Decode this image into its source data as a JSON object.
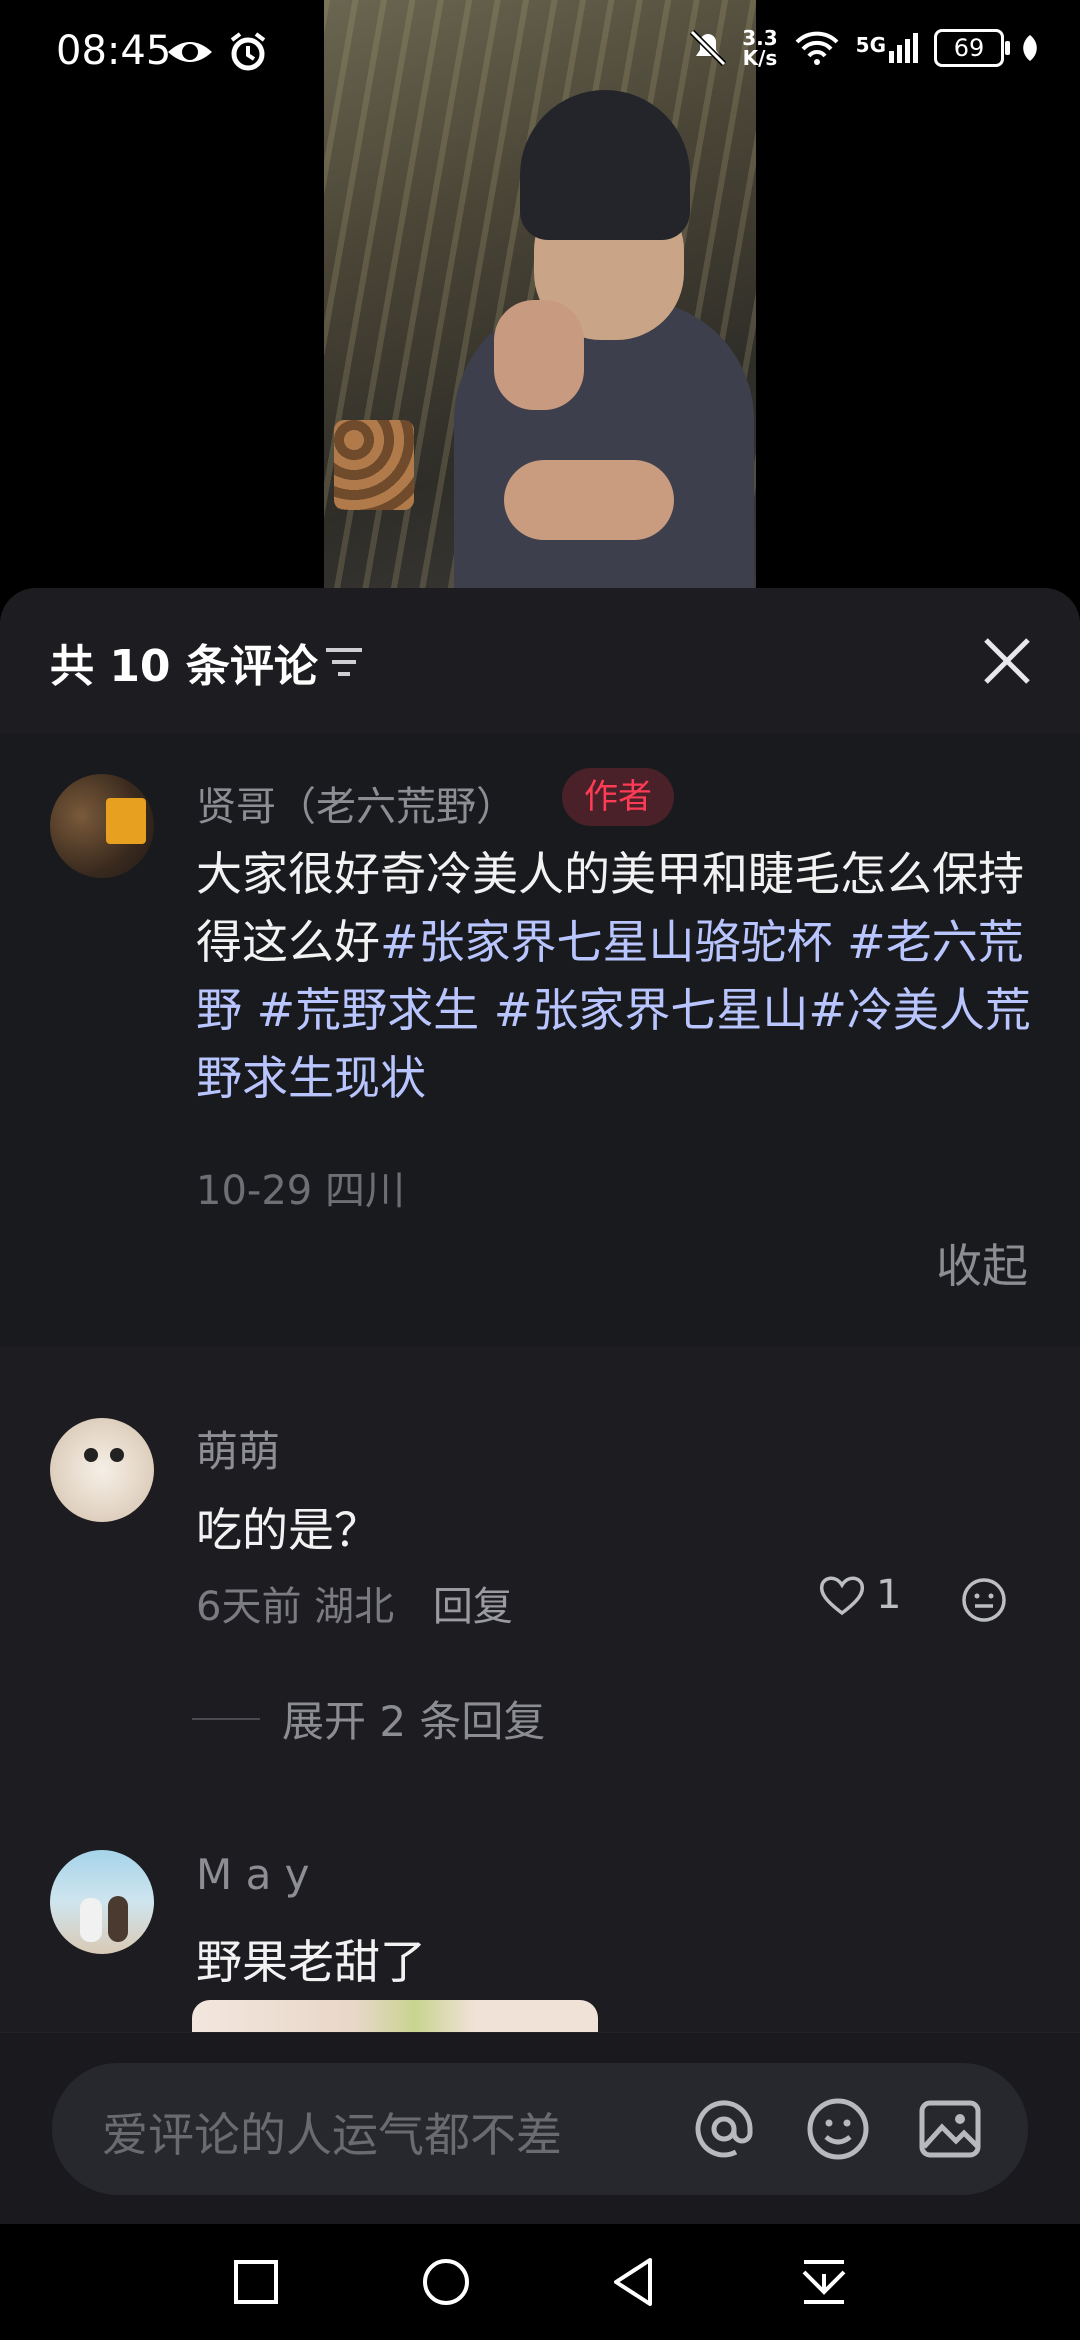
{
  "status_bar": {
    "time": "08:45",
    "net_speed_value": "3.3",
    "net_speed_unit": "K/s",
    "signal_label": "5G",
    "battery": "69"
  },
  "comments_panel": {
    "title": "共 10 条评论",
    "author_comment": {
      "name": "贤哥（老六荒野）",
      "tag": "作者",
      "text_plain": "大家很好奇冷美人的美甲和睫毛怎么保持得这么好",
      "hashtag_1": "#张家界七星山骆驼杯",
      "hashtag_2": "#老六荒野",
      "hashtag_3": "#荒野求生",
      "hashtag_4": "#张家界七星山#冷美人荒野求生现状",
      "meta": "10-29 四川",
      "collapse_label": "收起"
    },
    "comments": [
      {
        "name": "萌萌",
        "text": "吃的是？",
        "time": "6天前",
        "location": "湖北",
        "reply_label": "回复",
        "likes": "1",
        "expand_label": "展开 2 条回复"
      },
      {
        "name": "M a y",
        "text": "野果老甜了"
      }
    ]
  },
  "input": {
    "placeholder": "爱评论的人运气都不差"
  },
  "colors": {
    "panel_bg": "#1d1d21",
    "author_tag": "#ff3b55",
    "hashtag": "#b9c5ff"
  }
}
